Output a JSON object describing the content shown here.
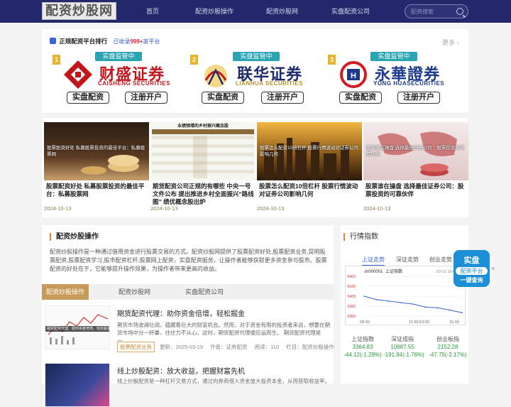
{
  "header": {
    "logo": "配资炒股网",
    "nav": [
      "首页",
      "配资炒股操作",
      "配资炒股网",
      "实盘配资公司"
    ],
    "search_placeholder": "配资搜索"
  },
  "ranking": {
    "title": "正规配资平台排行",
    "count_prefix": "已收录",
    "count": "999+",
    "count_suffix": "家平台",
    "more": "更多",
    "brokers": [
      {
        "rank": "1",
        "badge": "实盘监管中",
        "name": "财盛证券",
        "en": "CAISHENG SECURITIES",
        "btn1": "实盘配资",
        "btn2": "注册开户",
        "color": "#c0161c"
      },
      {
        "rank": "2",
        "badge": "实盘监管中",
        "name": "联华证券",
        "en": "LIANHUA SECURITIES",
        "btn1": "实盘配资",
        "btn2": "注册开户",
        "color": "#1d2a6e"
      },
      {
        "rank": "3",
        "badge": "实盘监管中",
        "name": "永華證券",
        "en": "YONG HUASECURITIES",
        "btn1": "实盘配资",
        "btn2": "注册开户",
        "color": "#1c3a8c"
      }
    ]
  },
  "news": [
    {
      "caption": "股票配资好处 私募股票投资的最佳平台：私募股票网",
      "title": "股票配资好处 私募股票投资的最佳平台：私募股票网",
      "date": "2024-10-13"
    },
    {
      "caption": "业绩预增的乡村振兴概念股",
      "title": "期货配资公司正规的有哪些 中央一号文件公布 提出推进乡村全面振兴“路线图” 绩优概念股出炉",
      "date": "2024-10-13"
    },
    {
      "caption": "股票怎么配资10倍杠杆 股票行情波动对证券公司影响几何",
      "title": "股票怎么配资10倍杠杆 股票行情波动对证券公司影响几何",
      "date": "2024-10-13"
    },
    {
      "caption": "股票谁在操盘 选择最佳证券公司：股票投资的可靠伙伴",
      "title": "股票谁在操盘 选择最佳证券公司：股票投资的可靠伙伴",
      "date": "2024-10-13"
    }
  ],
  "intro": {
    "title": "配资炒股操作",
    "text": "配资炒股操作是一种通过借用资金进行股票交易的方式。配资炒股网提供了股票配资好处,股票配资业务,昆明股票配资,股票配资学习,股市配资杠杆,股票网上配资，实盘配资服务，让操作者能够获取更多资金参与股市。股票配资的好处在于，它能够提升操作效果，为操作者带来更高的收益。"
  },
  "tabs": [
    "配资炒股操作",
    "配资炒股网",
    "实盘配资公司"
  ],
  "articles": [
    {
      "title": "期货配资代理：助你资金倍增，轻松掘金",
      "desc": "期货市场波澜壮阔，蕴藏着巨大的财富机会。然而，对于资金有限的投资者来说，想要在期货市场中分一杯羹，往往力不从心。这时，期货配资代理便应运而生。 期货配资代理是一...",
      "tag": "股票配资业务",
      "date": "更新：2025-03-19",
      "author": "作者：证券配资",
      "views": "阅读：110",
      "column": "栏目：配资炒股操作",
      "thumb_caption": "期货配资代理：助你资金倍增，轻松掘金"
    },
    {
      "title": "线上炒股配资：放大收益，把握财富先机",
      "desc": "线上炒股配资是一种杠杆交易方式，通过向券商借入资金放大投资本金，从而获取收益率。对于"
    }
  ],
  "sidebar": {
    "title": "行情指数",
    "tabs": [
      "上证走势",
      "深证走势",
      "创业走势"
    ],
    "chart": {
      "code": "sh000001",
      "name": "上证指数",
      "date": "03-21 15:00",
      "yticks": [
        "3462",
        "3436",
        "3409",
        "3382",
        "3356"
      ],
      "xticks": [
        "09:30",
        "11:30/13:00",
        "15:00"
      ]
    },
    "indices": [
      {
        "name": "上证指数",
        "value": "3364.83",
        "change": "-44.12(-1.29%)"
      },
      {
        "name": "深证成指",
        "value": "10687.55",
        "change": "-191.94(-1.76%)"
      },
      {
        "name": "创业板指",
        "value": "2152.28",
        "change": "-47.75(-2.17%)"
      }
    ]
  },
  "float_ad": {
    "line1": "实盘",
    "line2": "配资平台",
    "line3": "一键查询",
    "close": "×"
  },
  "chart_data": {
    "type": "line",
    "title": "上证指数",
    "x": [
      "09:30",
      "10:00",
      "10:30",
      "11:00",
      "11:30",
      "13:30",
      "14:00",
      "14:30",
      "15:00"
    ],
    "series": [
      {
        "name": "上证指数",
        "values": [
          3409,
          3400,
          3396,
          3392,
          3388,
          3380,
          3378,
          3372,
          3365
        ]
      }
    ],
    "ylim": [
      3356,
      3462
    ]
  }
}
